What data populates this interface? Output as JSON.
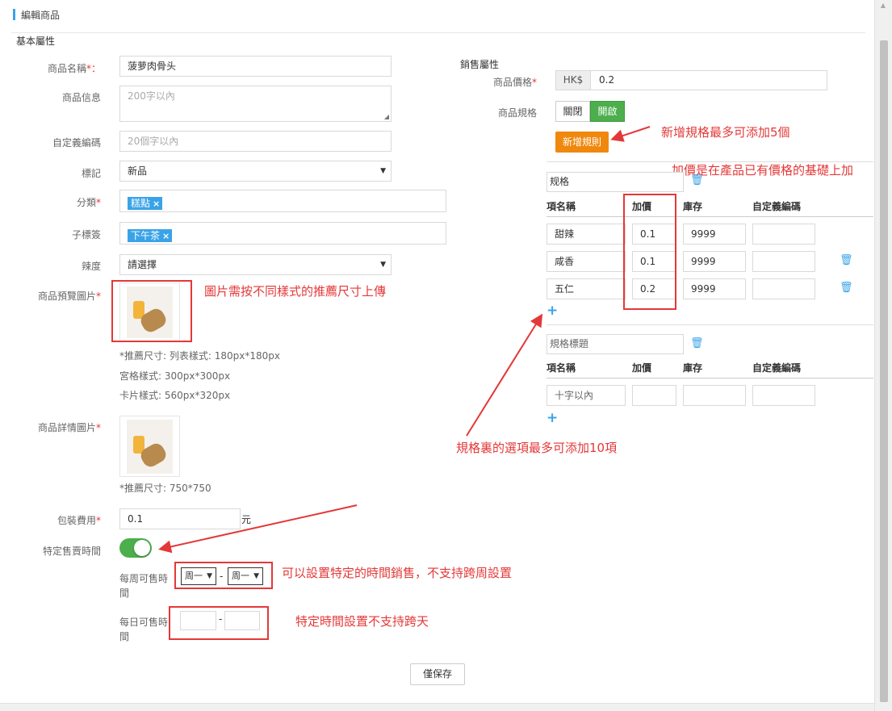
{
  "page": {
    "title": "編輯商品",
    "save_label": "僅保存"
  },
  "basic": {
    "section": "基本屬性",
    "name": {
      "label": "商品名稱",
      "req": "*",
      "colon": "：",
      "value": "菠萝肉骨头"
    },
    "info": {
      "label": "商品信息",
      "placeholder": "200字以內"
    },
    "code": {
      "label": "自定義編碼",
      "placeholder": "20個字以內"
    },
    "mark": {
      "label": "標記",
      "value": "新品"
    },
    "category": {
      "label": "分類",
      "req": "*",
      "tag": "糕點",
      "tag_x": "×"
    },
    "subtag": {
      "label": "子標簽",
      "tag": "下午茶",
      "tag_x": "×"
    },
    "spicy": {
      "label": "辣度",
      "value": "請選擇"
    },
    "preview": {
      "label": "商品預覽圖片",
      "req": "*",
      "hint1": "*推薦尺寸: 列表樣式: 180px*180px",
      "hint2": "宮格樣式: 300px*300px",
      "hint3": "卡片樣式: 560px*320px"
    },
    "detail": {
      "label": "商品詳情圖片",
      "req": "*",
      "hint": "*推薦尺寸: 750*750"
    },
    "packing": {
      "label": "包裝費用",
      "req": "*",
      "value": "0.1",
      "unit": "元"
    },
    "special_time": {
      "label": "特定售賣時間",
      "weekly_label": "每周可售時間",
      "week_from": "周一",
      "week_to": "周一",
      "dash": "-",
      "daily_label": "每日可售時間"
    }
  },
  "sales": {
    "section": "銷售屬性",
    "price": {
      "label": "商品價格",
      "req": "*",
      "currency": "HK$",
      "value": "0.2"
    },
    "spec": {
      "label": "商品規格",
      "off": "關閉",
      "on": "開啟"
    },
    "add_rule": "新增規則",
    "group1": {
      "title": "规格",
      "headers": [
        "項名稱",
        "加價",
        "庫存",
        "自定義編碼"
      ],
      "rows": [
        {
          "name": "甜辣",
          "price": "0.1",
          "stock": "9999",
          "code": ""
        },
        {
          "name": "咸香",
          "price": "0.1",
          "stock": "9999",
          "code": ""
        },
        {
          "name": "五仁",
          "price": "0.2",
          "stock": "9999",
          "code": ""
        }
      ]
    },
    "group2": {
      "title_placeholder": "規格標題",
      "headers": [
        "項名稱",
        "加價",
        "庫存",
        "自定義編碼"
      ],
      "row_placeholder": "十字以內"
    }
  },
  "annotations": {
    "a1": "新增規格最多可添加5個",
    "a2": "加價是在產品已有價格的基礎上加",
    "a3": "圖片需按不同樣式的推薦尺寸上傳",
    "a4": "規格裏的選項最多可添加10項",
    "a5": "可以設置特定的時間銷售，不支持跨周設置",
    "a6": "特定時間設置不支持跨天"
  },
  "colors": {
    "accent": "#3aa3e8",
    "toggle_on": "#4cae4c",
    "add_rule": "#f0880e",
    "annotation": "#e43838"
  }
}
